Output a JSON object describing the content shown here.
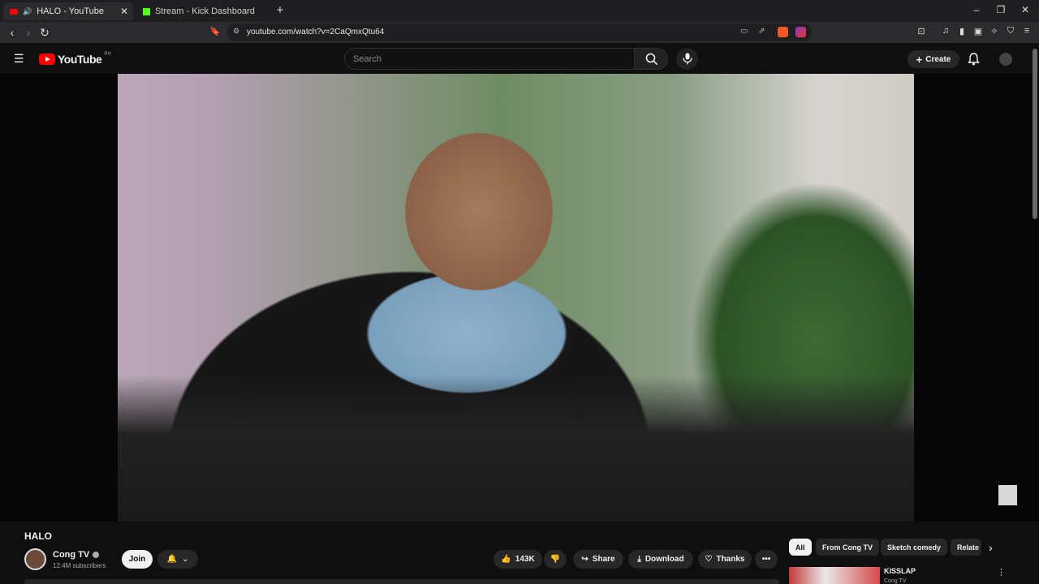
{
  "browser": {
    "tabs": [
      {
        "label": "HALO - YouTube",
        "active": true
      },
      {
        "label": "Stream - Kick Dashboard",
        "active": false
      }
    ],
    "new_tab": "+",
    "url": "youtube.com/watch?v=2CaQmxQtu64",
    "controls": {
      "minimize": "–",
      "restore": "❐",
      "close": "✕"
    }
  },
  "youtube": {
    "logo_text": "YouTube",
    "region": "PH",
    "search_placeholder": "Search",
    "create_label": "Create"
  },
  "video": {
    "title": "HALO",
    "channel": {
      "name": "Cong TV",
      "subscribers": "12.4M subscribers"
    },
    "join_label": "Join",
    "likes": "143K",
    "share_label": "Share",
    "download_label": "Download",
    "thanks_label": "Thanks",
    "more": "•••"
  },
  "chips": [
    "All",
    "From Cong TV",
    "Sketch comedy",
    "Relate"
  ],
  "related": {
    "title": "KISSLAP",
    "channel": "Cong TV"
  },
  "colors": {
    "youtube_red": "#ff0000",
    "kick_green": "#53fc18",
    "background": "#0f0f0f"
  }
}
